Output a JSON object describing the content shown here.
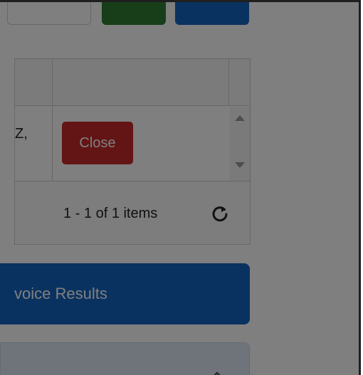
{
  "grid": {
    "row_cell_text": "Z,",
    "close_label": "Close",
    "pager_info": "1 - 1 of 1 items"
  },
  "results": {
    "title": "voice Results"
  },
  "icons": {
    "refresh": "refresh-icon",
    "chevron": "chevron-up-icon",
    "scroll_up": "scroll-up-arrow-icon",
    "scroll_down": "scroll-down-arrow-icon"
  },
  "colors": {
    "green_button": "#2e7d32",
    "blue_button": "#1565c0",
    "close_button": "#c62828",
    "results_bar": "#1565c0",
    "panel": "#dfe9f5",
    "backdrop": "rgba(0,0,0,0.5)"
  }
}
